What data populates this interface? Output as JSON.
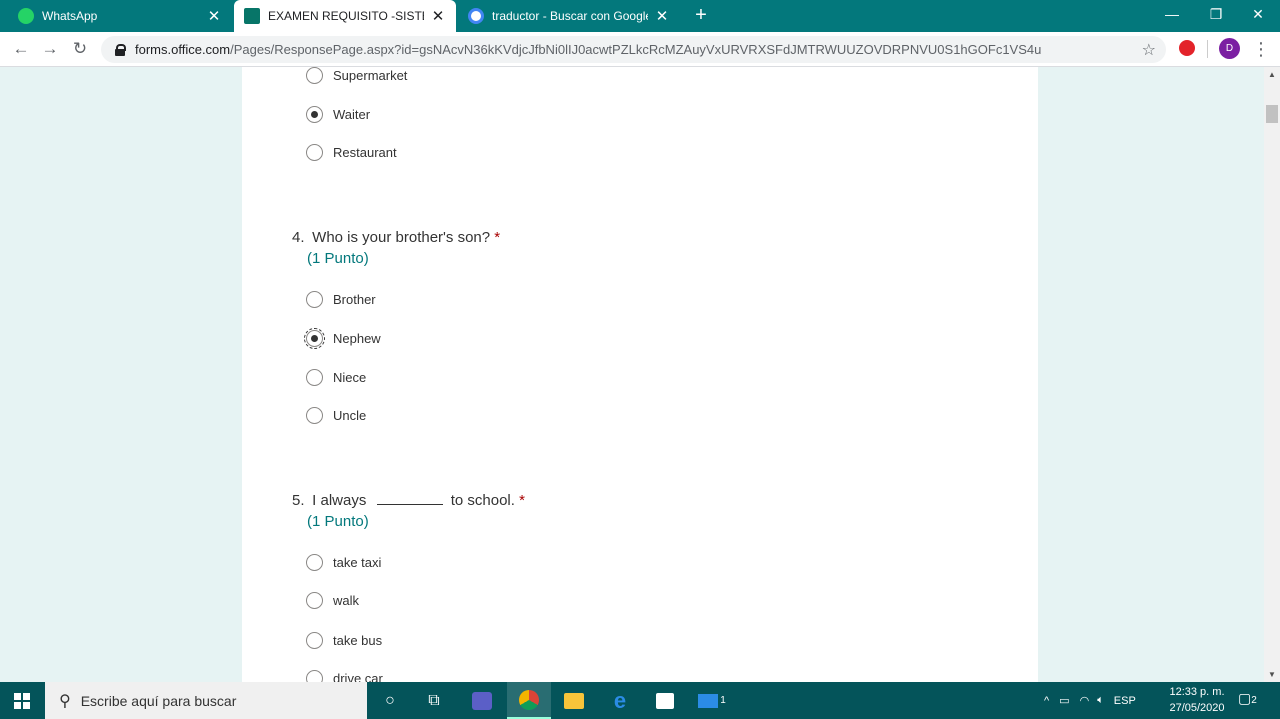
{
  "browser": {
    "tabs": [
      {
        "title": "WhatsApp",
        "icon": "whatsapp-icon",
        "active": false
      },
      {
        "title": "EXAMEN REQUISITO -SISTEMAS",
        "icon": "forms-icon",
        "active": true
      },
      {
        "title": "traductor - Buscar con Google",
        "icon": "google-icon",
        "active": false
      }
    ],
    "new_tab": "+",
    "url_host": "forms.office.com",
    "url_path": "/Pages/ResponsePage.aspx?id=gsNAcvN36kKVdjcJfbNi0lIJ0acwtPZLkcRcMZAuyVxURVRXSFdJMTRWUUZOVDRPNVU0S1hGOFc1VS4u",
    "profile_initial": "D"
  },
  "form": {
    "prev_options": [
      {
        "label": "Supermarket",
        "checked": false
      },
      {
        "label": "Waiter",
        "checked": true
      },
      {
        "label": "Restaurant",
        "checked": false
      }
    ],
    "questions": [
      {
        "number": "4.",
        "text": "Who is your brother's son?",
        "required": "*",
        "points": "(1 Punto)",
        "options": [
          {
            "label": "Brother",
            "checked": false
          },
          {
            "label": "Nephew",
            "checked": true
          },
          {
            "label": "Niece",
            "checked": false
          },
          {
            "label": "Uncle",
            "checked": false
          }
        ]
      },
      {
        "number": "5.",
        "text_before": "I always",
        "text_after": "to school.",
        "required": "*",
        "points": "(1 Punto)",
        "options": [
          {
            "label": "take taxi",
            "checked": false
          },
          {
            "label": "walk",
            "checked": false
          },
          {
            "label": "take bus",
            "checked": false
          },
          {
            "label": "drive car",
            "checked": false
          }
        ]
      }
    ]
  },
  "taskbar": {
    "search_placeholder": "Escribe aquí para buscar",
    "language": "ESP",
    "time": "12:33 p. m.",
    "date": "27/05/2020",
    "mail_badge": "1",
    "notification_count": "2"
  },
  "colors": {
    "accent": "#03787c",
    "taskbar": "#04545a",
    "required": "#a80000"
  }
}
